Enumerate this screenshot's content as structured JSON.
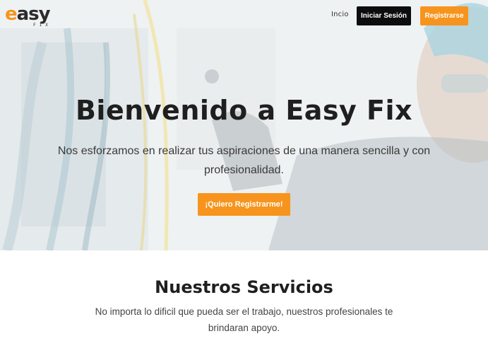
{
  "brand": {
    "logo_main": "asy",
    "logo_e": "e",
    "logo_sub": "FIX",
    "accent_color": "#f7941d",
    "dark_color": "#0d0d0d"
  },
  "nav": {
    "home_label": "Incio",
    "login_label": "Iniciar Sesión",
    "register_label": "Registrarse"
  },
  "hero": {
    "title": "Bienvenido a Easy Fix",
    "subtitle": "Nos esforzamos en realizar tus aspiraciones de una manera sencilla y con profesionalidad.",
    "cta_label": "¡Quiero Registrarme!",
    "image": "technician-working-on-electrical-panel"
  },
  "services": {
    "title": "Nuestros Servicios",
    "text": "No importa lo dificil que pueda ser el trabajo, nuestros profesionales te brindaran apoyo."
  }
}
